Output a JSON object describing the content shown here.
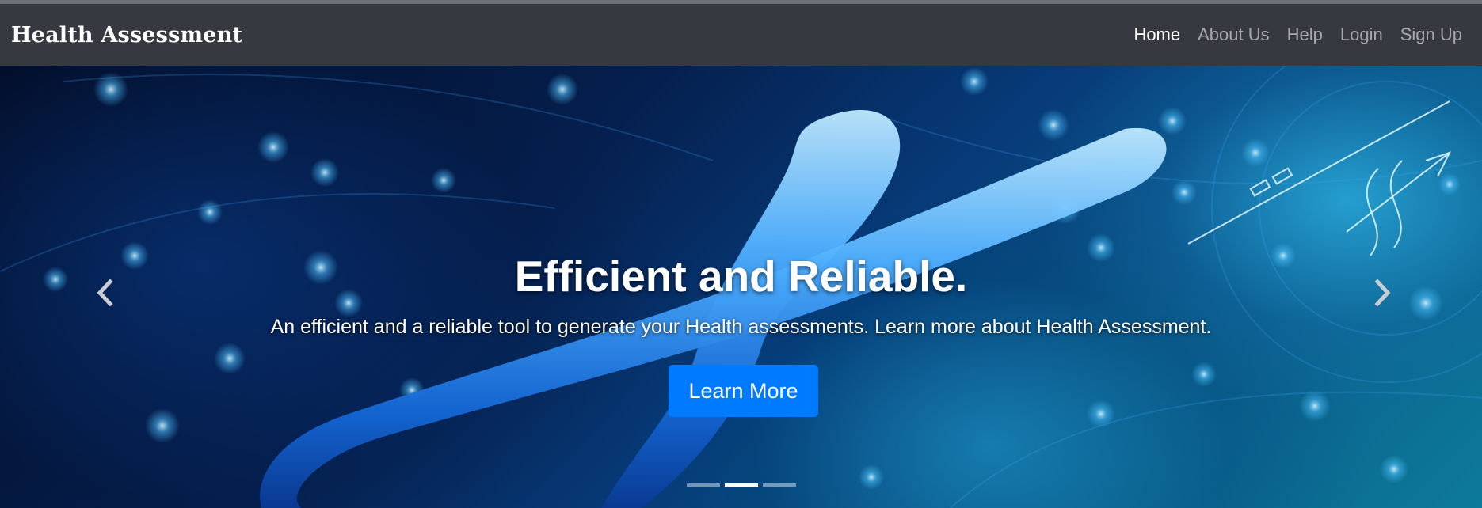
{
  "navbar": {
    "brand": "Health Assessment",
    "links": [
      {
        "label": "Home",
        "active": true
      },
      {
        "label": "About Us",
        "active": false
      },
      {
        "label": "Help",
        "active": false
      },
      {
        "label": "Login",
        "active": false
      },
      {
        "label": "Sign Up",
        "active": false
      }
    ]
  },
  "hero": {
    "headline": "Efficient and Reliable.",
    "subline": "An efficient and a reliable tool to generate your Health assessments. Learn more about Health Assessment.",
    "button_label": "Learn More",
    "prev_icon": "chevron-left-icon",
    "next_icon": "chevron-right-icon",
    "slide_count": 3,
    "active_slide": 2,
    "background_subject": "chromosome"
  },
  "colors": {
    "navbar_bg": "#363a40",
    "nav_link": "#a6a8ab",
    "nav_link_active": "#ffffff",
    "button_bg": "#007bff"
  }
}
